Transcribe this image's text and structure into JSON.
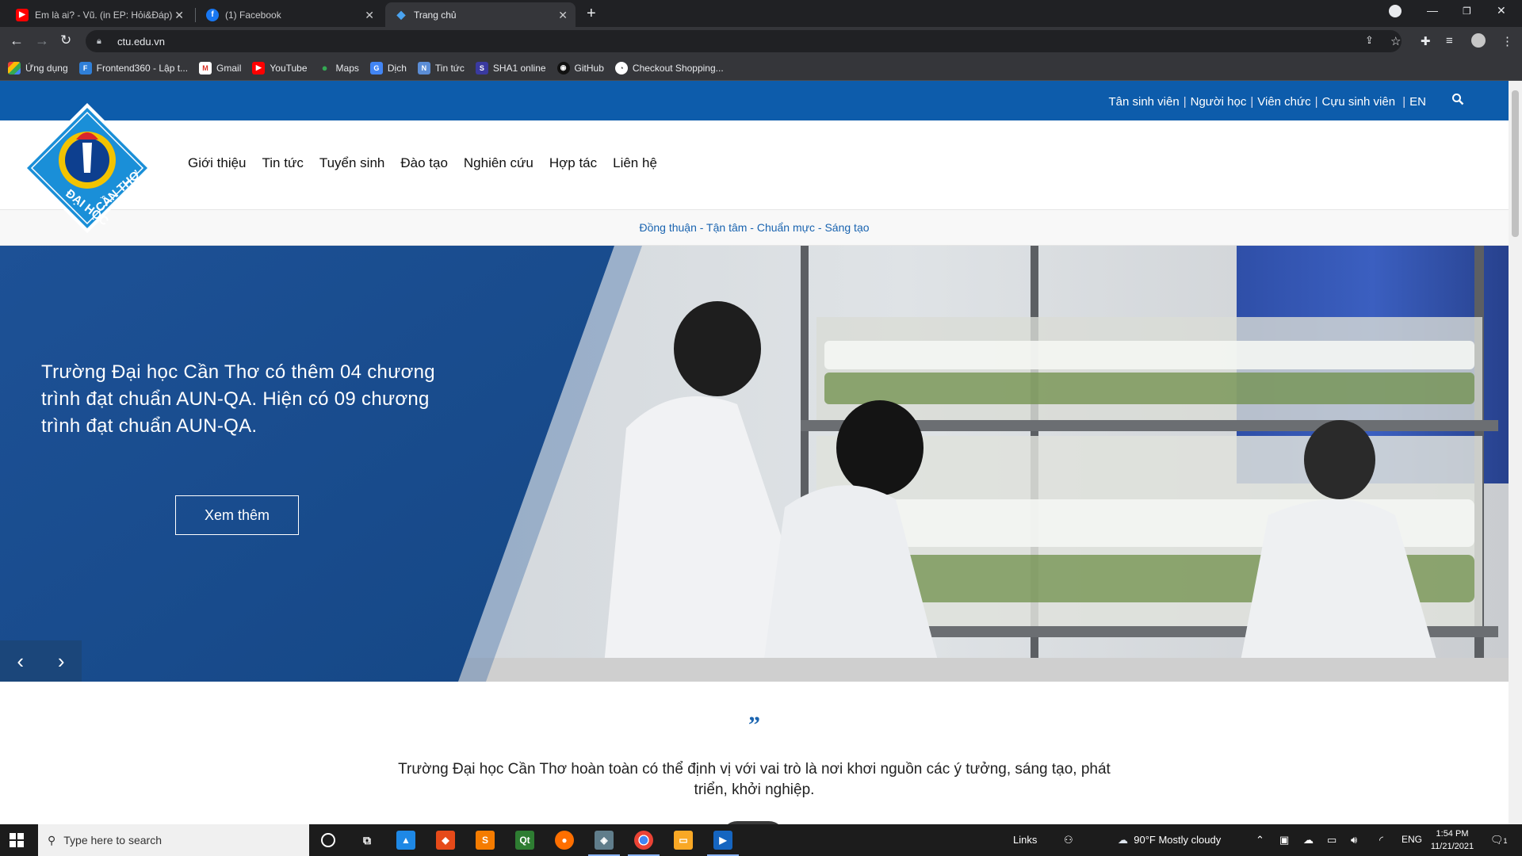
{
  "browser": {
    "tabs": [
      {
        "title": "Em là ai? - Vũ. (in EP: Hỏi&Đáp)",
        "icon": "youtube-icon",
        "active": false
      },
      {
        "title": "(1) Facebook",
        "icon": "facebook-icon",
        "active": false
      },
      {
        "title": "Trang chủ",
        "icon": "ctu-favicon-icon",
        "active": true
      }
    ],
    "url": "ctu.edu.vn",
    "bookmarks": [
      {
        "label": "Ứng dụng",
        "icon": "apps-grid-icon"
      },
      {
        "label": "Frontend360 - Lập t...",
        "icon": "frontend360-icon"
      },
      {
        "label": "Gmail",
        "icon": "gmail-icon"
      },
      {
        "label": "YouTube",
        "icon": "youtube-icon"
      },
      {
        "label": "Maps",
        "icon": "maps-pin-icon"
      },
      {
        "label": "Dịch",
        "icon": "translate-icon"
      },
      {
        "label": "Tin tức",
        "icon": "news-icon"
      },
      {
        "label": "SHA1 online",
        "icon": "sha1-icon"
      },
      {
        "label": "GitHub",
        "icon": "github-icon"
      },
      {
        "label": "Checkout Shopping...",
        "icon": "checkout-icon"
      }
    ]
  },
  "site": {
    "top_links": [
      "Tân sinh viên",
      "Người học",
      "Viên chức",
      "Cựu sinh viên",
      "EN"
    ],
    "logo_text": "ĐẠI HỌC CẦN THƠ",
    "nav": [
      "Giới thiệu",
      "Tin tức",
      "Tuyển sinh",
      "Đào tạo",
      "Nghiên cứu",
      "Hợp tác",
      "Liên hệ"
    ],
    "slogan": "Đồng thuận - Tận tâm - Chuẩn mực - Sáng tạo",
    "hero": {
      "headline": "Trường Đại học Cần Thơ có thêm 04 chương trình đạt chuẩn AUN-QA. Hiện có 09 chương trình đạt chuẩn AUN-QA.",
      "button": "Xem thêm"
    },
    "quote_mark": "”",
    "quote": "Trường Đại học Cần Thơ hoàn toàn có thể định vị với vai trò là nơi khơi nguồn các ý tưởng, sáng tạo, phát triển, khởi nghiệp.",
    "colors": {
      "brand_blue": "#0d5cab",
      "hero_blue": "#1a4e8e",
      "slogan_text": "#1a64b0"
    }
  },
  "taskbar": {
    "search_placeholder": "Type here to search",
    "links_label": "Links",
    "weather": "90°F  Mostly cloudy",
    "lang": "ENG",
    "time": "1:54 PM",
    "date": "11/21/2021",
    "notification_count": "1"
  }
}
